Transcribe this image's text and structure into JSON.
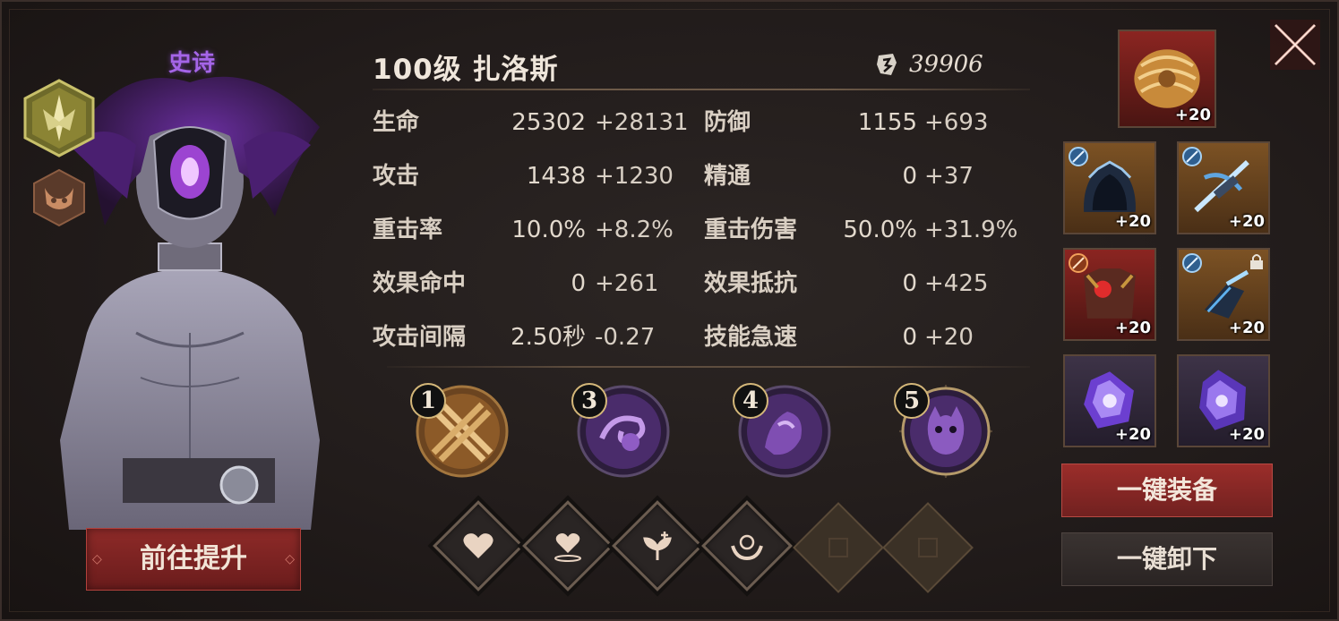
{
  "hero": {
    "rarity": "史诗",
    "title": "100级  扎洛斯",
    "power": "39906",
    "upgrade_label": "前往提升",
    "class_badge_icon": "class-emblem-icon",
    "faction_badge_icon": "faction-emblem-icon"
  },
  "stats": [
    {
      "label": "生命",
      "base": "25302",
      "bonus": "+28131"
    },
    {
      "label": "防御",
      "base": "1155",
      "bonus": "+693"
    },
    {
      "label": "攻击",
      "base": "1438",
      "bonus": "+1230"
    },
    {
      "label": "精通",
      "base": "0",
      "bonus": "+37"
    },
    {
      "label": "重击率",
      "base": "10.0%",
      "bonus": "+8.2%"
    },
    {
      "label": "重击伤害",
      "base": "50.0%",
      "bonus": "+31.9%"
    },
    {
      "label": "效果命中",
      "base": "0",
      "bonus": "+261"
    },
    {
      "label": "效果抵抗",
      "base": "0",
      "bonus": "+425"
    },
    {
      "label": "攻击间隔",
      "base": "2.50秒",
      "bonus": "-0.27"
    },
    {
      "label": "技能急速",
      "base": "0",
      "bonus": "+20"
    }
  ],
  "skills": [
    {
      "num": "1",
      "icon": "crossed-swords-icon"
    },
    {
      "num": "3",
      "icon": "purple-vortex-icon"
    },
    {
      "num": "4",
      "icon": "purple-spirit-icon"
    },
    {
      "num": "5",
      "icon": "demon-face-icon"
    }
  ],
  "runes": [
    {
      "icon": "heart-icon",
      "state": "active"
    },
    {
      "icon": "heart-aura-icon",
      "state": "active"
    },
    {
      "icon": "heal-sprout-icon",
      "state": "active"
    },
    {
      "icon": "guardian-hands-icon",
      "state": "active"
    },
    {
      "icon": "empty-slot-icon",
      "state": "empty"
    },
    {
      "icon": "empty-slot-icon",
      "state": "empty"
    }
  ],
  "equipment": {
    "top": {
      "level": "+20",
      "icon": "golden-chain-artifact-icon"
    },
    "slots": [
      {
        "level": "+20",
        "icon": "hooded-helm-icon"
      },
      {
        "level": "+20",
        "icon": "ice-crossbow-icon"
      },
      {
        "level": "+20",
        "icon": "crimson-armor-icon"
      },
      {
        "level": "+20",
        "icon": "frost-gauntlet-icon"
      },
      {
        "level": "+20",
        "icon": "purple-gem-icon"
      },
      {
        "level": "+20",
        "icon": "purple-crystal-icon"
      }
    ]
  },
  "buttons": {
    "equip_all": "一键装备",
    "unequip_all": "一键卸下"
  },
  "colors": {
    "accent_gold": "#d6a24b",
    "rarity_purple": "#a565e8",
    "primary_red": "#8e2a28"
  }
}
